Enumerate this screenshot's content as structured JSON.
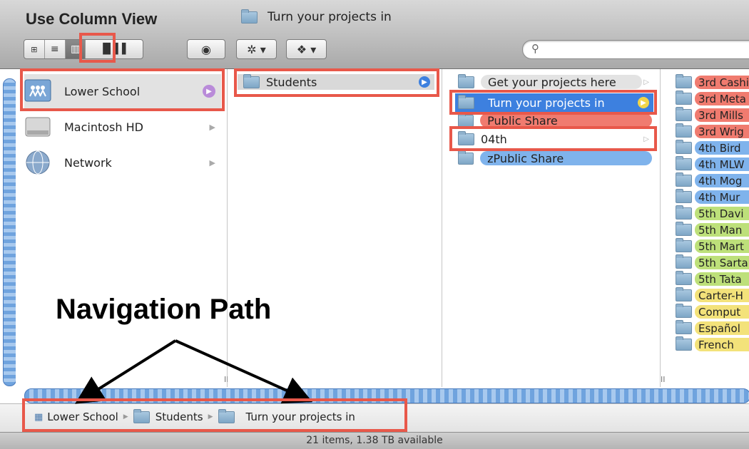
{
  "title": "Use Column View",
  "window_title": "Turn your projects in",
  "search": {
    "placeholder": ""
  },
  "sidebar": {
    "items": [
      {
        "label": "Lower School"
      },
      {
        "label": "Macintosh HD"
      },
      {
        "label": "Network"
      }
    ]
  },
  "column1": {
    "items": [
      {
        "label": "Students"
      }
    ]
  },
  "column2": {
    "items": [
      {
        "label": "Get your projects here"
      },
      {
        "label": "Turn your projects in"
      },
      {
        "label": "Public Share"
      },
      {
        "label": "04th"
      },
      {
        "label": "zPublic Share"
      }
    ]
  },
  "column3": {
    "items": [
      {
        "label": "3rd Cashi",
        "color": "#f07b6f"
      },
      {
        "label": "3rd Meta",
        "color": "#f07b6f"
      },
      {
        "label": "3rd Mills",
        "color": "#f07b6f"
      },
      {
        "label": "3rd Wrig",
        "color": "#f07b6f"
      },
      {
        "label": "4th Bird",
        "color": "#7fb3ec"
      },
      {
        "label": "4th MLW",
        "color": "#7fb3ec"
      },
      {
        "label": "4th Mog",
        "color": "#7fb3ec"
      },
      {
        "label": "4th Mur",
        "color": "#7fb3ec"
      },
      {
        "label": "5th Davi",
        "color": "#bde07a"
      },
      {
        "label": "5th Man",
        "color": "#bde07a"
      },
      {
        "label": "5th Mart",
        "color": "#bde07a"
      },
      {
        "label": "5th Sarta",
        "color": "#bde07a"
      },
      {
        "label": "5th Tata",
        "color": "#bde07a"
      },
      {
        "label": "Carter-H",
        "color": "#f3e27a"
      },
      {
        "label": "Comput",
        "color": "#f3e27a"
      },
      {
        "label": "Español",
        "color": "#f3e27a"
      },
      {
        "label": "French",
        "color": "#f3e27a"
      }
    ]
  },
  "path_bar": {
    "items": [
      "Lower School",
      "Students",
      "Turn your projects in"
    ]
  },
  "status": "21 items, 1.38 TB available",
  "annotation": "Navigation Path",
  "colors": {
    "highlight": "#e8584a",
    "selection": "#3d80df"
  }
}
